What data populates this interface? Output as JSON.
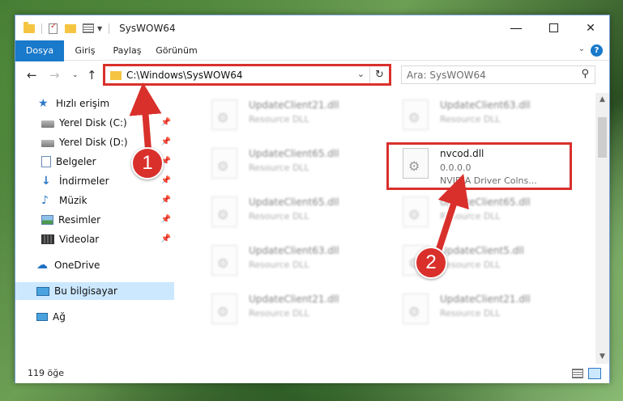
{
  "window": {
    "title": "SysWOW64",
    "controls": {
      "minimize": "—",
      "close": "✕"
    }
  },
  "ribbon": {
    "tabs": [
      {
        "label": "Dosya"
      },
      {
        "label": "Giriş"
      },
      {
        "label": "Paylaş"
      },
      {
        "label": "Görünüm"
      }
    ],
    "help": "?"
  },
  "address": {
    "path": "C:\\Windows\\SysWOW64"
  },
  "search": {
    "placeholder": "Ara: SysWOW64"
  },
  "sidebar": {
    "items": [
      {
        "label": "Hızlı erişim",
        "icon": "star-icon"
      },
      {
        "label": "Yerel Disk (C:)",
        "icon": "disk-icon",
        "pinned": true
      },
      {
        "label": "Yerel Disk (D:)",
        "icon": "disk-icon",
        "pinned": true
      },
      {
        "label": "Belgeler",
        "icon": "documents-icon",
        "pinned": true
      },
      {
        "label": "İndirmeler",
        "icon": "download-icon",
        "pinned": true
      },
      {
        "label": "Müzik",
        "icon": "music-icon",
        "pinned": true
      },
      {
        "label": "Resimler",
        "icon": "pictures-icon",
        "pinned": true
      },
      {
        "label": "Videolar",
        "icon": "videos-icon",
        "pinned": true
      },
      {
        "label": "OneDrive",
        "icon": "cloud-icon"
      },
      {
        "label": "Bu bilgisayar",
        "icon": "computer-icon",
        "selected": true
      },
      {
        "label": "Ağ",
        "icon": "network-icon"
      }
    ]
  },
  "files": {
    "items": [
      {
        "name": "UpdateClient21.dll",
        "desc": "Resource DLL"
      },
      {
        "name": "UpdateClient63.dll",
        "desc": "Resource DLL"
      },
      {
        "name": "UpdateClient65.dll",
        "desc": "Resource DLL"
      },
      {
        "name": "nvcod.dll",
        "version": "0.0.0.0",
        "desc": "NVIDIA Driver Colns..."
      },
      {
        "name": "UpdateClient65.dll",
        "desc": "Resource DLL"
      },
      {
        "name": "UpdateClient65.dll",
        "desc": "Resource DLL"
      },
      {
        "name": "UpdateClient63.dll",
        "desc": "Resource DLL"
      },
      {
        "name": "UpdateClient5.dll",
        "desc": "Resource DLL"
      },
      {
        "name": "UpdateClient21.dll",
        "desc": "Resource DLL"
      },
      {
        "name": "UpdateClient21.dll",
        "desc": "Resource DLL"
      }
    ]
  },
  "status": {
    "count": "119 öğe"
  },
  "annotations": {
    "badge1": "1",
    "badge2": "2"
  },
  "colors": {
    "accent": "#1979ca",
    "highlight": "#d9302c",
    "selection": "#cce8ff"
  }
}
